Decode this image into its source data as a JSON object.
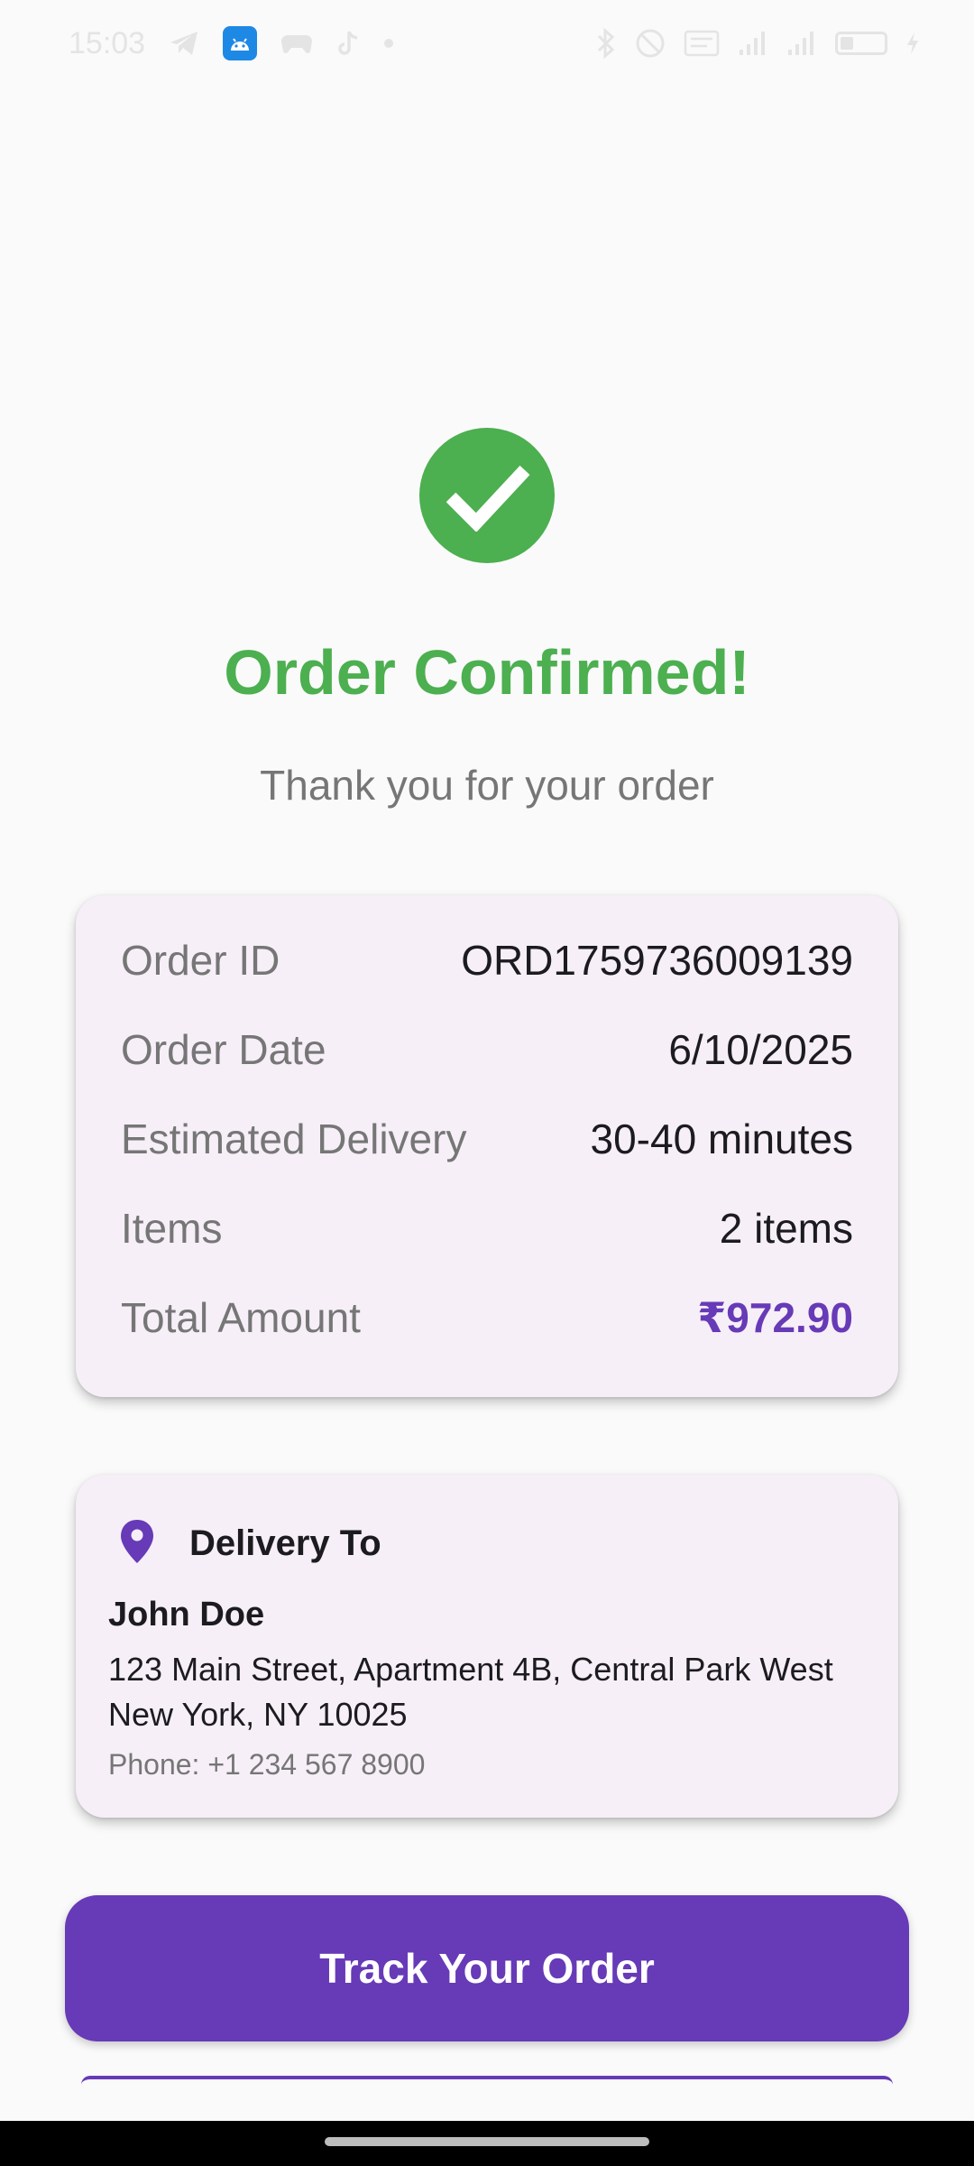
{
  "status_bar": {
    "time": "15:03"
  },
  "confirmation": {
    "icon": "check-circle-icon",
    "title": "Order Confirmed!",
    "subtitle": "Thank you for your order"
  },
  "order_details": [
    {
      "label": "Order ID",
      "value": "ORD1759736009139"
    },
    {
      "label": "Order Date",
      "value": "6/10/2025"
    },
    {
      "label": "Estimated Delivery",
      "value": "30-40 minutes"
    },
    {
      "label": "Items",
      "value": "2 items"
    },
    {
      "label": "Total Amount",
      "value": "₹972.90"
    }
  ],
  "delivery": {
    "icon": "location-pin-icon",
    "title": "Delivery To",
    "name": "John Doe",
    "address_line1": "123 Main Street, Apartment 4B, Central Park West",
    "address_line2": "New York, NY 10025",
    "phone": "Phone: +1 234 567 8900"
  },
  "actions": {
    "track_label": "Track Your Order"
  },
  "colors": {
    "success": "#4caf50",
    "accent": "#673ab7",
    "card_background": "#f6eff7",
    "muted_text": "#767676"
  }
}
